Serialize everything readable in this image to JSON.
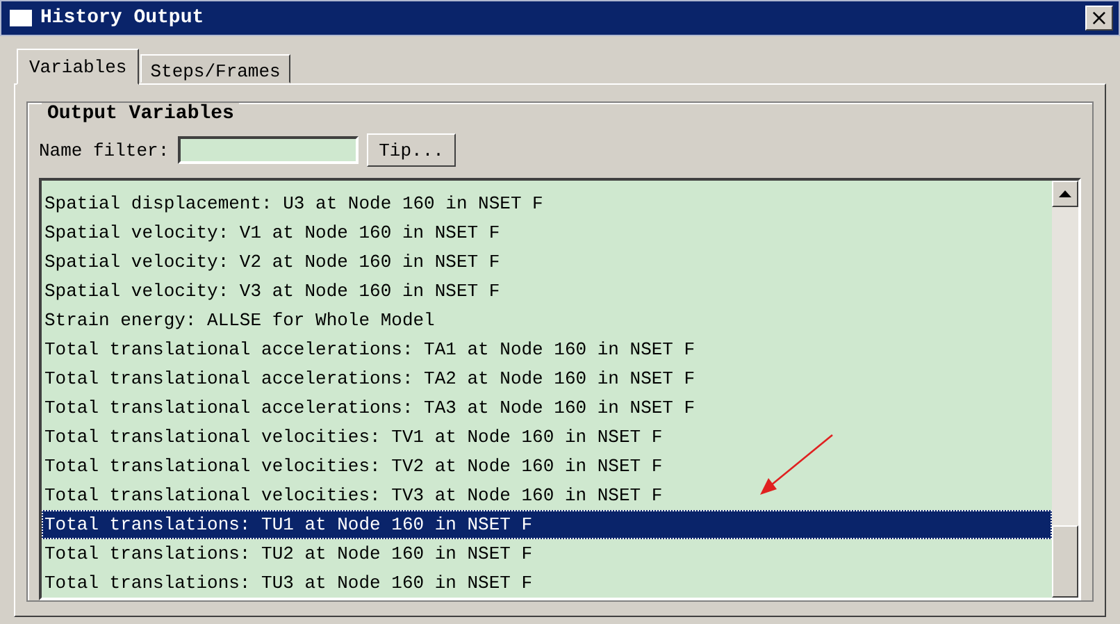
{
  "window": {
    "title": "History Output",
    "close": "×"
  },
  "tabs": [
    {
      "label": "Variables",
      "selected": true
    },
    {
      "label": "Steps/Frames",
      "selected": false
    }
  ],
  "group": {
    "title": "Output Variables"
  },
  "filter": {
    "label": "Name filter:",
    "button": "Tip..."
  },
  "list": [
    {
      "text": "Spatial displacement: U3 at Node 160 in NSET F",
      "selected": false
    },
    {
      "text": "Spatial velocity: V1 at Node 160 in NSET F",
      "selected": false
    },
    {
      "text": "Spatial velocity: V2 at Node 160 in NSET F",
      "selected": false
    },
    {
      "text": "Spatial velocity: V3 at Node 160 in NSET F",
      "selected": false
    },
    {
      "text": "Strain energy: ALLSE for Whole Model",
      "selected": false
    },
    {
      "text": "Total translational accelerations: TA1 at Node 160 in NSET F",
      "selected": false
    },
    {
      "text": "Total translational accelerations: TA2 at Node 160 in NSET F",
      "selected": false
    },
    {
      "text": "Total translational accelerations: TA3 at Node 160 in NSET F",
      "selected": false
    },
    {
      "text": "Total translational velocities: TV1 at Node 160 in NSET F",
      "selected": false
    },
    {
      "text": "Total translational velocities: TV2 at Node 160 in NSET F",
      "selected": false
    },
    {
      "text": "Total translational velocities: TV3 at Node 160 in NSET F",
      "selected": false
    },
    {
      "text": "Total translations: TU1 at Node 160 in NSET F",
      "selected": true
    },
    {
      "text": "Total translations: TU2 at Node 160 in NSET F",
      "selected": false
    },
    {
      "text": "Total translations: TU3 at Node 160 in NSET F",
      "selected": false
    }
  ]
}
